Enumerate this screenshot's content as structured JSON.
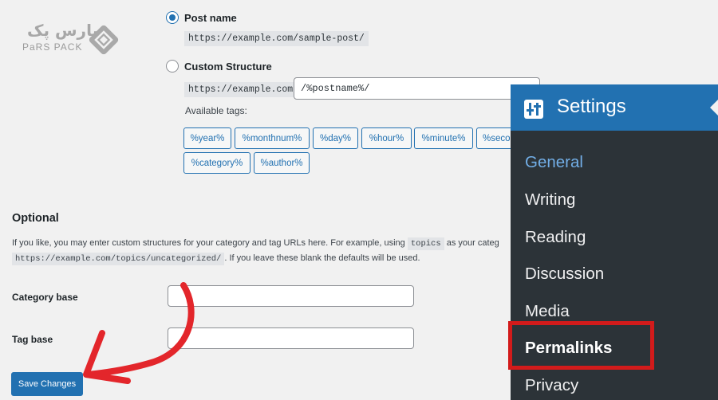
{
  "watermark": {
    "brand_fa": "پارس پک",
    "brand_en": "PaRS PACK"
  },
  "structure": {
    "post_name": {
      "label": "Post name",
      "example": "https://example.com/sample-post/",
      "checked": true
    },
    "custom": {
      "label": "Custom Structure",
      "prefix": "https://example.com",
      "value": "/%postname%/",
      "checked": false
    },
    "available_tags_label": "Available tags:",
    "tags": [
      "%year%",
      "%monthnum%",
      "%day%",
      "%hour%",
      "%minute%",
      "%seco",
      "%category%",
      "%author%"
    ]
  },
  "optional": {
    "title": "Optional",
    "desc_line1_before": "If you like, you may enter custom structures for your category and tag URLs here. For example, using",
    "desc_code": "topics",
    "desc_line1_after": "as your categ",
    "desc_line2_code": "https://example.com/topics/uncategorized/",
    "desc_line2_after": ". If you leave these blank the defaults will be used.",
    "category_base_label": "Category base",
    "category_base_value": "",
    "tag_base_label": "Tag base",
    "tag_base_value": ""
  },
  "save_button": "Save Changes",
  "settings_menu": {
    "title": "Settings",
    "items": [
      "General",
      "Writing",
      "Reading",
      "Discussion",
      "Media",
      "Permalinks",
      "Privacy"
    ]
  },
  "colors": {
    "wp_blue": "#2271b1",
    "menu_bg": "#2c3338",
    "highlight_red": "#d21b1b",
    "current_item": "#72aee6"
  }
}
